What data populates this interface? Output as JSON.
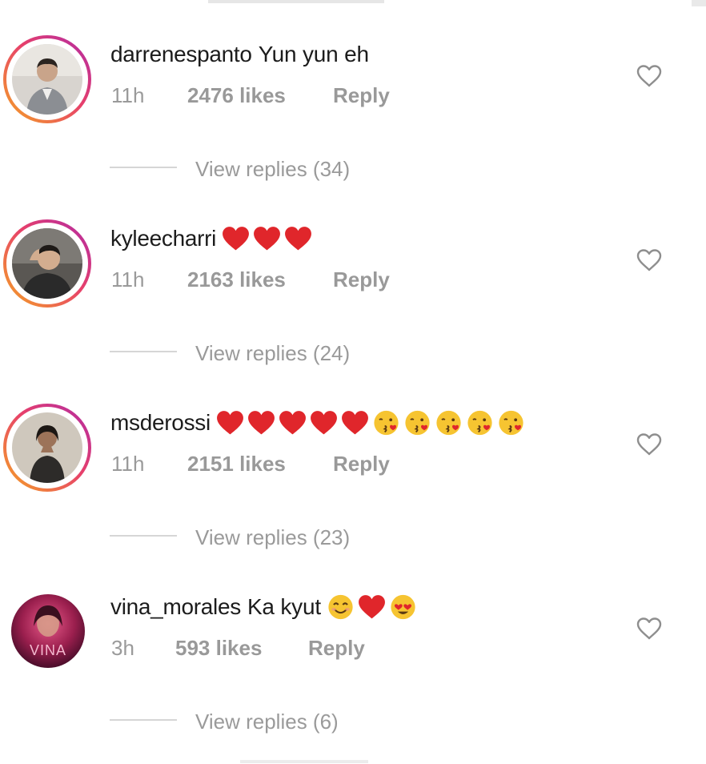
{
  "comments": [
    {
      "username": "darrenespanto",
      "text": "Yun yun eh",
      "time": "11h",
      "likes": "2476 likes",
      "reply_label": "Reply",
      "view_replies": "View replies (34)",
      "avatar_style": "story-ring"
    },
    {
      "username": "kyleecharri",
      "text": "",
      "emojis": [
        "red-heart-icon",
        "red-heart-icon",
        "red-heart-icon"
      ],
      "time": "11h",
      "likes": "2163 likes",
      "reply_label": "Reply",
      "view_replies": "View replies (24)",
      "avatar_style": "story-ring"
    },
    {
      "username": "msderossi",
      "text": "",
      "emojis": [
        "red-heart-icon",
        "red-heart-icon",
        "red-heart-icon",
        "red-heart-icon",
        "red-heart-icon",
        "kissing-face-icon",
        "kissing-face-icon",
        "kissing-face-icon",
        "kissing-face-icon",
        "kissing-face-icon"
      ],
      "time": "11h",
      "likes": "2151 likes",
      "reply_label": "Reply",
      "view_replies": "View replies (23)",
      "avatar_style": "story-ring"
    },
    {
      "username": "vina_morales",
      "text": "Ka kyut",
      "emojis": [
        "smiling-face-icon",
        "red-heart-icon",
        "heart-eyes-face-icon"
      ],
      "time": "3h",
      "likes": "593 likes",
      "reply_label": "Reply",
      "view_replies": "View replies (6)",
      "avatar_style": "plain",
      "avatar_text": "VINA"
    }
  ],
  "colors": {
    "heart_red": "#e0262b",
    "meta_gray": "#9a9a9a",
    "ring_gradient": [
      "#f5a623",
      "#e7406b",
      "#b02aa6"
    ]
  }
}
